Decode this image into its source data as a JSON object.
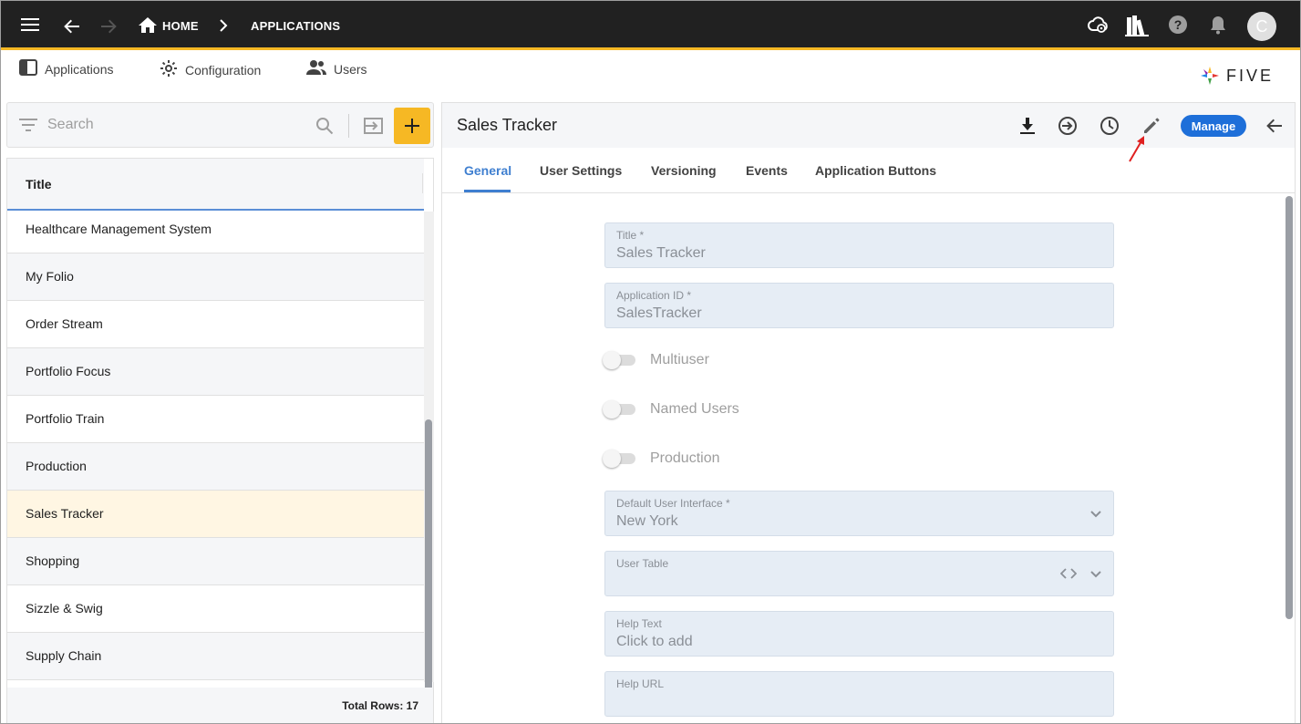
{
  "appbar": {
    "breadcrumb_home": "HOME",
    "breadcrumb_current": "APPLICATIONS",
    "avatar_initial": "C"
  },
  "menu": {
    "items": [
      {
        "label": "Applications",
        "icon": "applications-icon"
      },
      {
        "label": "Configuration",
        "icon": "gear-icon"
      },
      {
        "label": "Users",
        "icon": "users-icon"
      }
    ],
    "brand": "FIVE"
  },
  "list": {
    "search_placeholder": "Search",
    "column_title": "Title",
    "rows": [
      "Healthcare Management System",
      "My Folio",
      "Order Stream",
      "Portfolio Focus",
      "Portfolio Train",
      "Production",
      "Sales Tracker",
      "Shopping",
      "Sizzle & Swig",
      "Supply Chain"
    ],
    "selected": "Sales Tracker",
    "footer": "Total Rows: 17"
  },
  "detail": {
    "title": "Sales Tracker",
    "manage_label": "Manage",
    "tabs": [
      "General",
      "User Settings",
      "Versioning",
      "Events",
      "Application Buttons"
    ],
    "active_tab": "General",
    "fields": {
      "title_label": "Title *",
      "title_value": "Sales Tracker",
      "appid_label": "Application ID *",
      "appid_value": "SalesTracker",
      "ui_label": "Default User Interface *",
      "ui_value": "New York",
      "usertable_label": "User Table",
      "helptext_label": "Help Text",
      "helptext_value": "Click to add",
      "helpurl_label": "Help URL"
    },
    "toggles": {
      "multiuser": "Multiuser",
      "named_users": "Named Users",
      "production": "Production"
    }
  },
  "colors": {
    "appbar_bg": "#212121",
    "accent_yellow": "#f6b824",
    "primary_blue": "#1e6fd9",
    "selected_row": "#fff6e3",
    "annotation_red": "#e02020"
  }
}
